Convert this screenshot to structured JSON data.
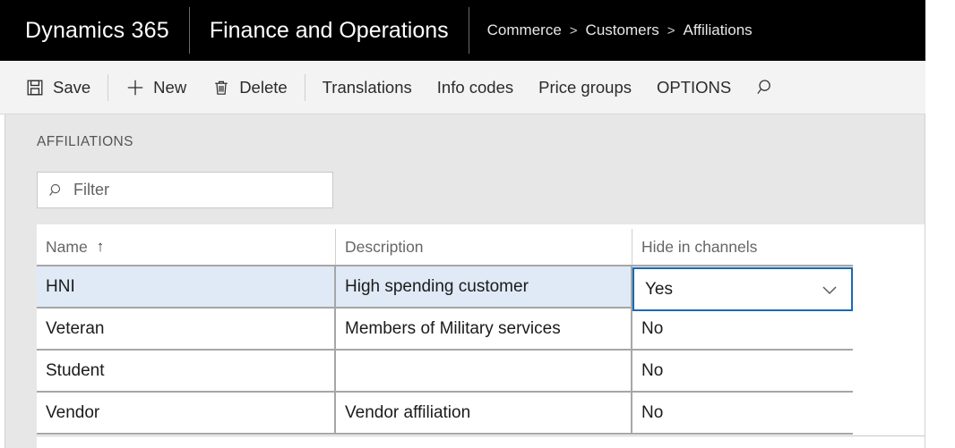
{
  "navbar": {
    "brand": "Dynamics 365",
    "app": "Finance and Operations",
    "breadcrumb": {
      "items": [
        "Commerce",
        "Customers",
        "Affiliations"
      ],
      "separator": ">"
    }
  },
  "toolbar": {
    "save_label": "Save",
    "new_label": "New",
    "delete_label": "Delete",
    "translations_label": "Translations",
    "info_codes_label": "Info codes",
    "price_groups_label": "Price groups",
    "options_label": "OPTIONS",
    "search_icon": "search-icon",
    "save_icon": "save-floppy-icon",
    "new_icon": "plus-icon",
    "delete_icon": "trash-icon"
  },
  "page": {
    "section_title": "AFFILIATIONS"
  },
  "filter": {
    "placeholder": "Filter",
    "value": "",
    "icon": "search-icon"
  },
  "grid": {
    "columns": [
      {
        "label": "Name",
        "sort": "↑"
      },
      {
        "label": "Description",
        "sort": ""
      },
      {
        "label": "Hide in channels",
        "sort": ""
      }
    ],
    "rows": [
      {
        "name": "HNI",
        "description": "High spending customer",
        "hide_in_channels": "Yes",
        "selected": true
      },
      {
        "name": "Veteran",
        "description": "Members of Military services",
        "hide_in_channels": "No",
        "selected": false
      },
      {
        "name": "Student",
        "description": "",
        "hide_in_channels": "No",
        "selected": false
      },
      {
        "name": "Vendor",
        "description": "Vendor affiliation",
        "hide_in_channels": "No",
        "selected": false
      }
    ],
    "active_cell": {
      "value": "Yes",
      "icon": "chevron-down-icon"
    }
  },
  "colors": {
    "navbar_bg": "#000000",
    "command_bar_bg": "#f3f3f3",
    "content_bg": "#e7e7e7",
    "selected_row": "#dfeaf6",
    "focus_border": "#1a6ab5"
  }
}
